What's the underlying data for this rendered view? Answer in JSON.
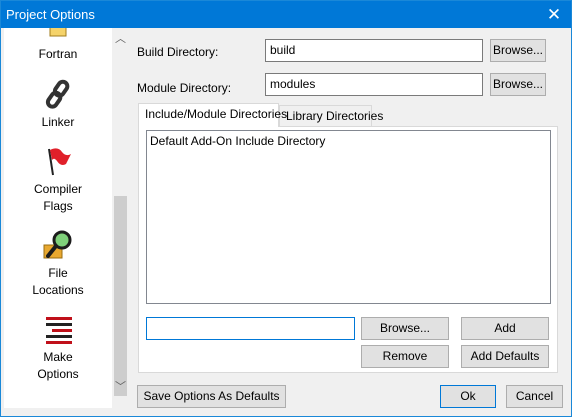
{
  "window": {
    "title": "Project Options"
  },
  "sidebar": {
    "items": [
      {
        "label_line1": "Fortran",
        "label_line2": "",
        "icon": "fortran-icon"
      },
      {
        "label_line1": "Linker",
        "label_line2": "",
        "icon": "chain-link-icon"
      },
      {
        "label_line1": "Compiler",
        "label_line2": "Flags",
        "icon": "red-flag-icon"
      },
      {
        "label_line1": "File",
        "label_line2": "Locations",
        "icon": "magnifier-folder-icon"
      },
      {
        "label_line1": "Make",
        "label_line2": "Options",
        "icon": "make-lines-icon"
      }
    ]
  },
  "form": {
    "build_dir_label": "Build Directory:",
    "build_dir_value": "build",
    "module_dir_label": "Module Directory:",
    "module_dir_value": "modules",
    "browse_label": "Browse..."
  },
  "tabs": [
    {
      "label": "Include/Module Directories",
      "active": true
    },
    {
      "label": "Library Directories",
      "active": false
    }
  ],
  "include_list": {
    "items": [
      "Default Add-On Include Directory"
    ],
    "new_entry_value": "",
    "browse_label": "Browse...",
    "add_label": "Add",
    "remove_label": "Remove",
    "add_defaults_label": "Add Defaults"
  },
  "footer": {
    "save_defaults_label": "Save Options As Defaults",
    "ok_label": "Ok",
    "cancel_label": "Cancel"
  },
  "colors": {
    "titlebar": "#0078d7",
    "focus": "#0078d7"
  }
}
